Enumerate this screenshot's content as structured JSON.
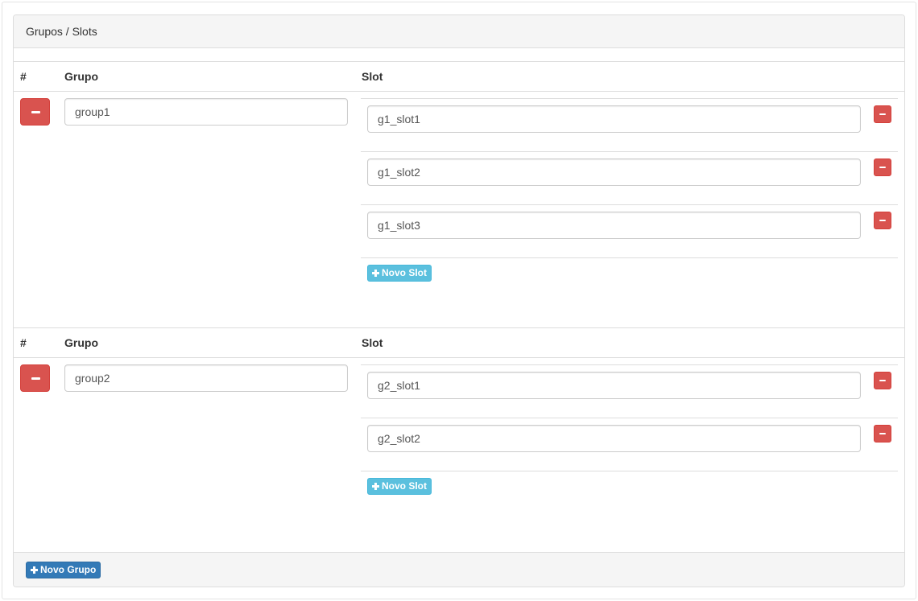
{
  "panel": {
    "breadcrumb": "Grupos / Slots",
    "new_group_label": "Novo Grupo"
  },
  "table_headers": {
    "index": "#",
    "group": "Grupo",
    "slot": "Slot"
  },
  "groups": [
    {
      "name": "group1",
      "slots": [
        "g1_slot1",
        "g1_slot2",
        "g1_slot3"
      ],
      "new_slot_label": "Novo Slot"
    },
    {
      "name": "group2",
      "slots": [
        "g2_slot1",
        "g2_slot2"
      ],
      "new_slot_label": "Novo Slot"
    }
  ],
  "colors": {
    "danger": "#d9534f",
    "info": "#5bc0de",
    "primary": "#337ab7"
  },
  "icons": [
    "minus-icon",
    "plus-icon"
  ]
}
